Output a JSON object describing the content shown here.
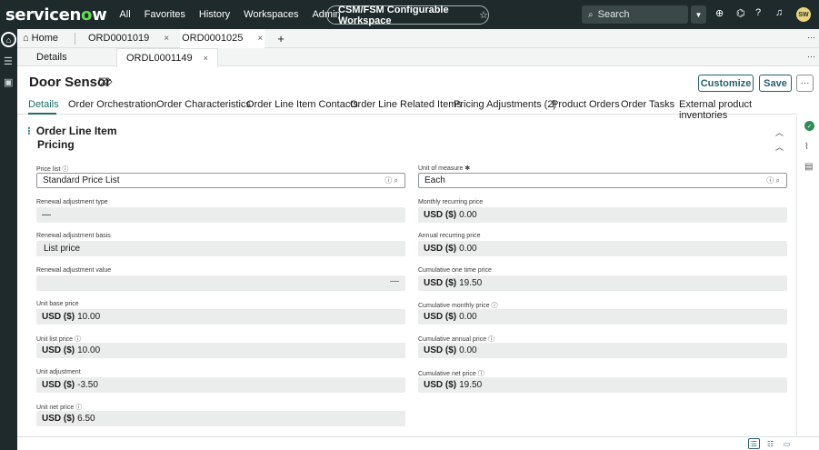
{
  "nav": {
    "logo_pre": "servicen",
    "logo_o": "o",
    "logo_post": "w",
    "links": [
      "All",
      "Favorites",
      "History",
      "Workspaces",
      "Admin"
    ],
    "workspace": "CSM/FSM Configurable Workspace",
    "search_placeholder": "Search",
    "avatar_initials": "SW"
  },
  "tabs": {
    "home": "Home",
    "records": [
      "ORD0001019",
      "ORD0001025"
    ],
    "add": "+"
  },
  "subtabs": {
    "details": "Details",
    "active": "ORDL0001149"
  },
  "record": {
    "title": "Door Sensor",
    "customize_label": "Customize",
    "save_label": "Save"
  },
  "record_tabs": [
    "Details",
    "Order Orchestration",
    "Order Characteristics",
    "Order Line Item Contacts",
    "Order Line Related Items",
    "Pricing Adjustments (2)",
    "Product Orders",
    "Order Tasks",
    "External product inventories"
  ],
  "form": {
    "section_title": "Order Line Item",
    "subsection_title": "Pricing",
    "currency_prefix": "USD ($)",
    "left": [
      {
        "label": "Price list",
        "value": "Standard Price List"
      },
      {
        "label": "Renewal adjustment type",
        "value": "—"
      },
      {
        "label": "Renewal adjustment basis",
        "value": "List price"
      },
      {
        "label": "Renewal adjustment value",
        "value": "—"
      },
      {
        "label": "Unit base price",
        "value": "10.00"
      },
      {
        "label": "Unit list price",
        "value": "10.00"
      },
      {
        "label": "Unit adjustment",
        "value": "-3.50"
      },
      {
        "label": "Unit net price",
        "value": "6.50"
      }
    ],
    "right": [
      {
        "label": "Unit of measure",
        "value": "Each"
      },
      {
        "label": "Monthly recurring price",
        "value": "0.00"
      },
      {
        "label": "Annual recurring price",
        "value": "0.00"
      },
      {
        "label": "Cumulative one time price",
        "value": "19.50"
      },
      {
        "label": "Cumulative monthly price",
        "value": "0.00"
      },
      {
        "label": "Cumulative annual price",
        "value": "0.00"
      },
      {
        "label": "Cumulative net price",
        "value": "19.50"
      }
    ]
  }
}
